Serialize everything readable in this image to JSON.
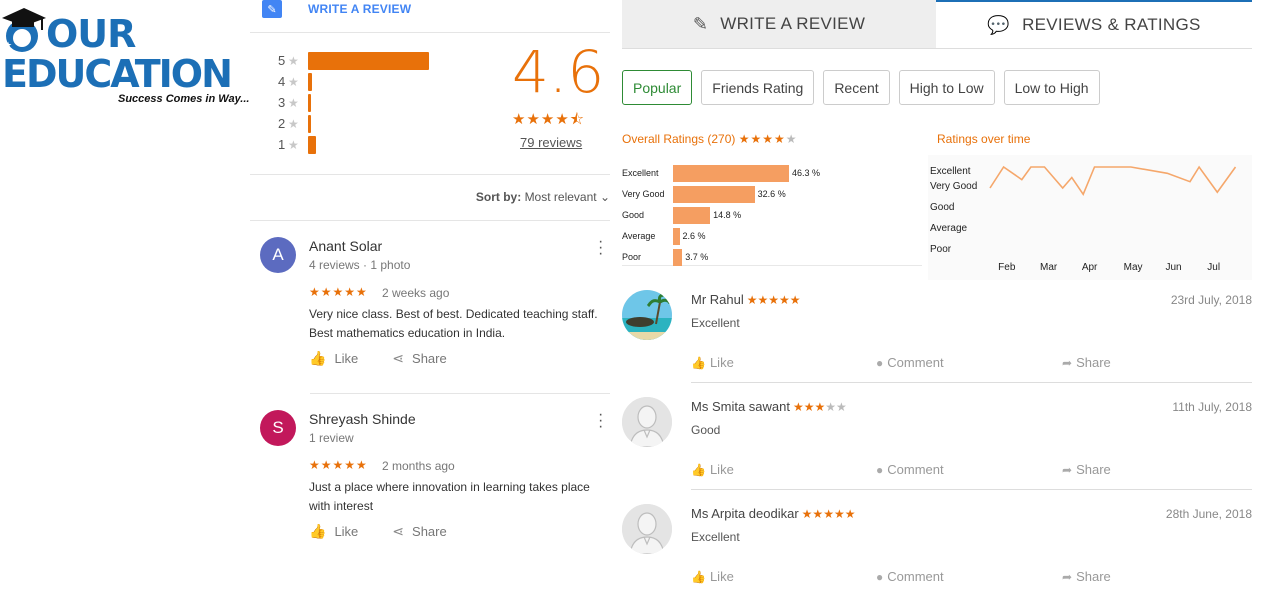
{
  "logo": {
    "line1": "OUR",
    "line2": "EDUCATION",
    "tagline": "Success Comes in Way..."
  },
  "google_panel": {
    "write_review": "WRITE A REVIEW",
    "distribution": [
      {
        "stars": "5",
        "fraction": 0.92
      },
      {
        "stars": "4",
        "fraction": 0.03
      },
      {
        "stars": "3",
        "fraction": 0.02
      },
      {
        "stars": "2",
        "fraction": 0.02
      },
      {
        "stars": "1",
        "fraction": 0.06
      }
    ],
    "average": "4.6",
    "average_stars": "★★★★⯪",
    "reviews_count": "79 reviews",
    "sort_label": "Sort by:",
    "sort_value": "Most relevant",
    "reviews": [
      {
        "initial": "A",
        "avatar_color": "#5c6bc0",
        "name": "Anant Solar",
        "meta": "4 reviews · 1 photo",
        "stars": "★★★★★",
        "when": "2 weeks ago",
        "text": "Very nice class. Best of best. Dedicated teaching staff. Best mathematics education in India.",
        "like": "Like",
        "share": "Share"
      },
      {
        "initial": "S",
        "avatar_color": "#c2185b",
        "name": "Shreyash Shinde",
        "meta": "1 review",
        "stars": "★★★★★",
        "when": "2 months ago",
        "text": "Just a place where innovation in learning takes place with interest",
        "like": "Like",
        "share": "Share"
      }
    ]
  },
  "right_panel": {
    "tabs": [
      {
        "label": "WRITE A REVIEW",
        "icon": "pencil-icon"
      },
      {
        "label": "REVIEWS & RATINGS",
        "icon": "speech-bubble-icon"
      }
    ],
    "filters": [
      "Popular",
      "Friends Rating",
      "Recent",
      "High to Low",
      "Low to High"
    ],
    "active_filter": "Popular",
    "overall_title": "Overall Ratings (270)",
    "overall_stars_filled": "★★★★",
    "overall_stars_empty": "★",
    "time_title": "Ratings over time",
    "reviews": [
      {
        "name": "Mr Rahul",
        "stars_filled": "★★★★★",
        "stars_empty": "",
        "date": "23rd July, 2018",
        "text": "Excellent",
        "avatar": "beach-photo",
        "like": "Like",
        "comment": "Comment",
        "share": "Share"
      },
      {
        "name": "Ms Smita sawant",
        "stars_filled": "★★★",
        "stars_empty": "★★",
        "date": "11th July, 2018",
        "text": "Good",
        "avatar": "default-user",
        "like": "Like",
        "comment": "Comment",
        "share": "Share"
      },
      {
        "name": "Ms Arpita deodikar",
        "stars_filled": "★★★★★",
        "stars_empty": "",
        "date": "28th June, 2018",
        "text": "Excellent",
        "avatar": "default-user",
        "like": "Like",
        "comment": "Comment",
        "share": "Share"
      }
    ]
  },
  "chart_data": [
    {
      "type": "bar",
      "orientation": "horizontal",
      "title": "Overall Ratings (270)",
      "categories": [
        "Excellent",
        "Very Good",
        "Good",
        "Average",
        "Poor"
      ],
      "values": [
        46.3,
        32.6,
        14.8,
        2.6,
        3.7
      ],
      "value_labels": [
        "46.3 %",
        "32.6 %",
        "14.8 %",
        "2.6 %",
        "3.7 %"
      ],
      "color": "#f59e61"
    },
    {
      "type": "line",
      "title": "Ratings over time",
      "x_ticks": [
        "Feb",
        "Mar",
        "Apr",
        "May",
        "Jun",
        "Jul"
      ],
      "y_ticks": [
        "Excellent",
        "Very Good",
        "Good",
        "Average",
        "Poor"
      ],
      "y_scale": {
        "Excellent": 5,
        "Very Good": 4,
        "Good": 3,
        "Average": 2,
        "Poor": 1
      },
      "points_x": [
        0.0,
        0.3,
        0.7,
        0.9,
        1.2,
        1.6,
        1.8,
        2.05,
        2.3,
        2.4,
        2.5,
        2.6,
        3.1,
        3.9,
        4.4,
        4.6,
        5.0,
        5.4
      ],
      "points_y": [
        4.0,
        5.0,
        4.4,
        5.0,
        5.0,
        4.0,
        4.5,
        3.7,
        5.0,
        5.0,
        5.0,
        5.0,
        5.0,
        4.7,
        4.3,
        5.0,
        3.8,
        5.0
      ],
      "color": "#f5a76b"
    }
  ]
}
